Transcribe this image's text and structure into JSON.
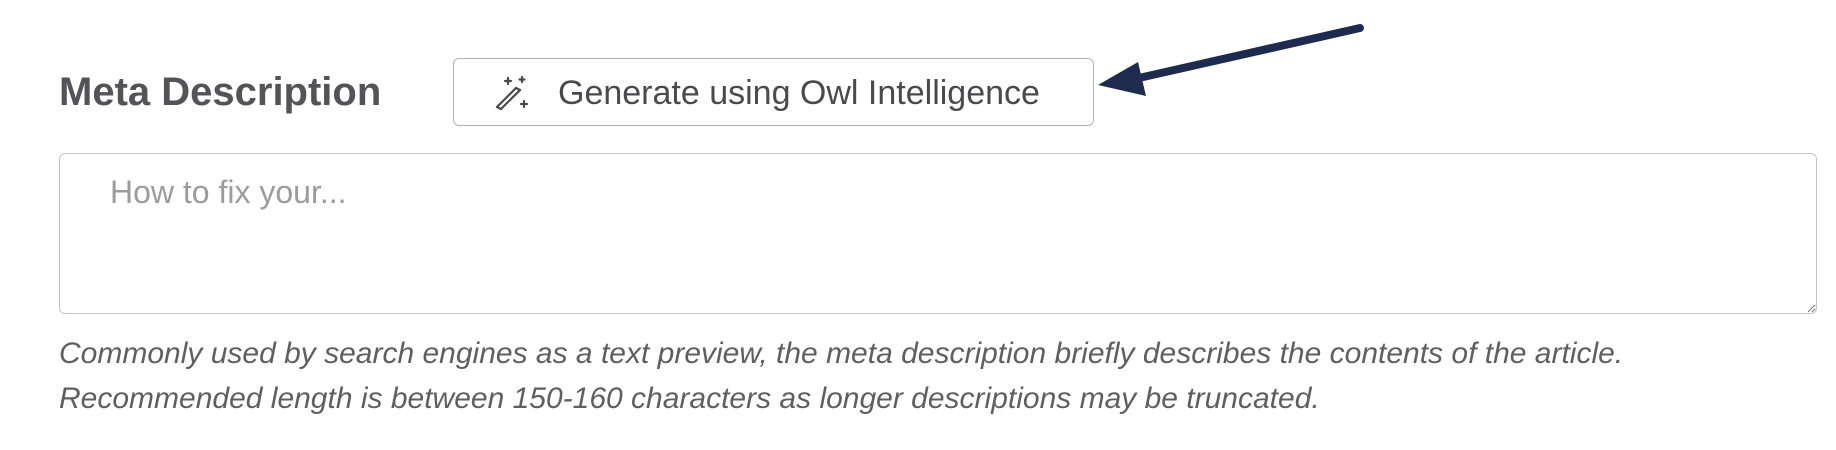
{
  "field": {
    "label": "Meta Description",
    "generate_button_label": "Generate using Owl Intelligence",
    "generate_button_icon": "magic-wand-icon",
    "placeholder": "How to fix your...",
    "value": "",
    "help_line_1": "Commonly used by search engines as a text preview, the meta description briefly describes the contents of the article.",
    "help_line_2": "Recommended length is between 150-160 characters as longer descriptions may be truncated."
  },
  "annotation": {
    "arrow_color": "#1f2a4f"
  }
}
